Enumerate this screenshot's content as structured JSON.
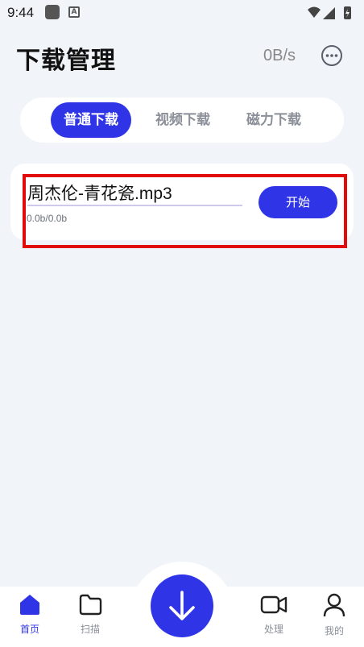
{
  "status_bar": {
    "time": "9:44"
  },
  "header": {
    "title": "下载管理",
    "speed": "0B/s"
  },
  "tabs": [
    {
      "label": "普通下载",
      "active": true
    },
    {
      "label": "视频下载",
      "active": false
    },
    {
      "label": "磁力下载",
      "active": false
    }
  ],
  "downloads": [
    {
      "file_name": "周杰伦-青花瓷.mp3",
      "size_text": "0.0b/0.0b",
      "progress": 0,
      "action_label": "开始"
    }
  ],
  "bottom_nav": [
    {
      "label": "首页",
      "icon": "home-icon",
      "active": true
    },
    {
      "label": "扫描",
      "icon": "folder-icon",
      "active": false
    },
    {
      "label": "处理",
      "icon": "video-camera-icon",
      "active": false
    },
    {
      "label": "我的",
      "icon": "user-icon",
      "active": false
    }
  ],
  "colors": {
    "accent": "#2f35e6",
    "background": "#f1f4f9",
    "highlight": "#e10b0b"
  }
}
